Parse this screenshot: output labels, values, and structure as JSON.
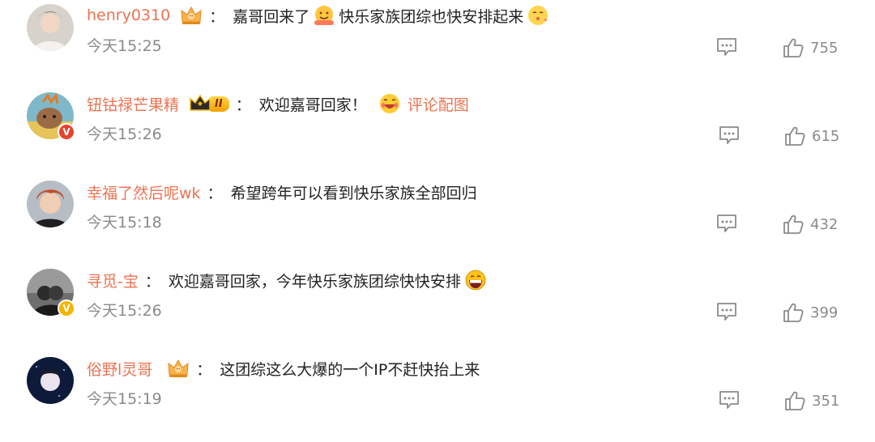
{
  "comments": [
    {
      "user": "henry0310",
      "colon": "：",
      "text_a": "嘉哥回来了",
      "text_b": "快乐家族团综也快安排起来",
      "time": "今天15:25",
      "likes": "755"
    },
    {
      "user": "钮钴禄芒果精",
      "colon": "：",
      "text_a": "欢迎嘉哥回家！",
      "link": "评论配图",
      "badge_text": "II",
      "time": "今天15:26",
      "likes": "615"
    },
    {
      "user": "幸福了然后呢wk",
      "colon": "：",
      "text_a": "希望跨年可以看到快乐家族全部回归",
      "time": "今天15:18",
      "likes": "432"
    },
    {
      "user": "寻觅-宝",
      "colon": "：",
      "text_a": "欢迎嘉哥回家，今年快乐家族团综快快安排",
      "time": "今天15:26",
      "likes": "399"
    },
    {
      "user": "俗野l灵哥",
      "colon": "：",
      "text_a": "这团综这么大爆的一个IP不赶快抬上来",
      "time": "今天15:19",
      "likes": "351"
    }
  ],
  "badge_colors": {
    "red_v": "#e8412c",
    "gold_v": "#f5b400",
    "username": "#eb7350"
  },
  "icons": {
    "reply": "comment-icon",
    "like": "thumbs-up-icon",
    "crown": "crown-icon"
  }
}
